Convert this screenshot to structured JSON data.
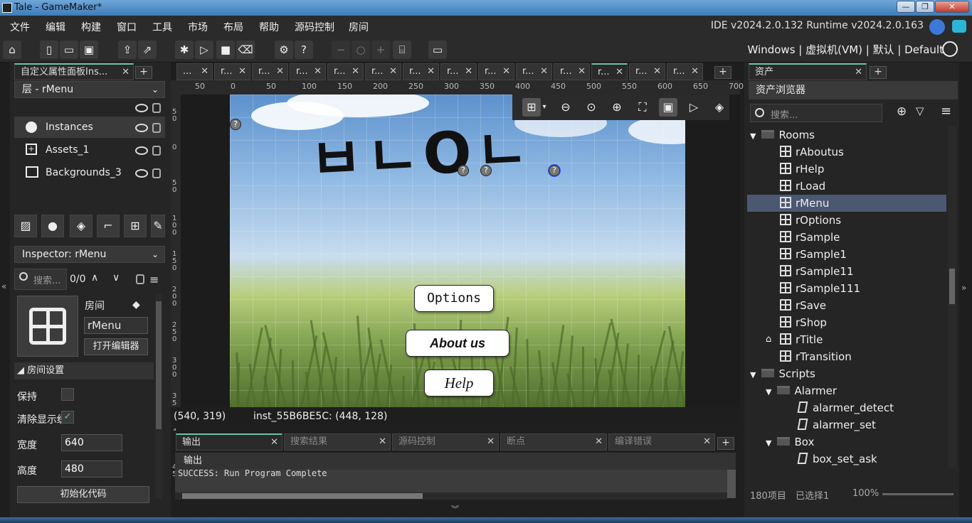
{
  "window": {
    "title": "Tale - GameMaker*",
    "min": "—",
    "max": "❐",
    "close": "✕"
  },
  "menu": [
    "文件",
    "编辑",
    "构建",
    "窗口",
    "工具",
    "市场",
    "布局",
    "帮助",
    "源码控制",
    "房间"
  ],
  "ide_info": "IDE v2024.2.0.132  Runtime v2024.2.0.163",
  "target": "Windows | 虚拟机(VM) | 默认 | Default",
  "left_panel": {
    "tab": "自定义属性面板Ins...",
    "layer_dropdown": "层 - rMenu",
    "layers": [
      {
        "name": "Instances",
        "icon": "instances-icon"
      },
      {
        "name": "Assets_1",
        "icon": "assets-layer-icon"
      },
      {
        "name": "Backgrounds_3",
        "icon": "background-layer-icon"
      }
    ],
    "inspector_dropdown": "Inspector: rMenu",
    "search_placeholder": "搜索...",
    "search_count": "0/0",
    "room_kind_label": "房间",
    "room_name": "rMenu",
    "open_editor": "打开编辑器",
    "section": "房间设置",
    "persistent_label": "保持",
    "clear_display_label": "清除显示缓",
    "width_label": "宽度",
    "width_value": "640",
    "height_label": "高度",
    "height_value": "480",
    "init_code": "初始化代码"
  },
  "editor_tabs": [
    "...",
    "r...",
    "r...",
    "r...",
    "r...",
    "r...",
    "r...",
    "r...",
    "r...",
    "r...",
    "r...",
    "r...",
    "r...",
    "r..."
  ],
  "ruler_top": [
    "50",
    "0",
    "50",
    "100",
    "150",
    "200",
    "250",
    "300",
    "350",
    "400",
    "450",
    "500",
    "550",
    "600",
    "650",
    "700"
  ],
  "ruler_left": [
    "5\n0",
    "0",
    "5\n0",
    "1\n0\n0",
    "1\n5\n0",
    "2\n0\n0",
    "2\n5\n0",
    "3\n0\n0",
    "3\n5\n0",
    "4\n0\n0",
    "4\n5"
  ],
  "room": {
    "logo_text": "ㅂㄴOㄴ",
    "buttons": {
      "options": "Options",
      "about": "About us",
      "help": "Help"
    },
    "marker": "?"
  },
  "status": {
    "cursor": "(540, 319)",
    "instance": "inst_55B6BE5C: (448, 128)"
  },
  "output": {
    "tabs": [
      "输出",
      "搜索结果",
      "源码控制",
      "断点",
      "编译错误"
    ],
    "header": "输出",
    "text": "SUCCESS: Run Program Complete"
  },
  "assets": {
    "tab": "资产",
    "browser_title": "资产浏览器",
    "search_placeholder": "搜索...",
    "rooms_folder": "Rooms",
    "rooms": [
      "rAboutus",
      "rHelp",
      "rLoad",
      "rMenu",
      "rOptions",
      "rSample",
      "rSample1",
      "rSample11",
      "rSample111",
      "rSave",
      "rShop",
      "rTitle",
      "rTransition"
    ],
    "selected_room": "rMenu",
    "scripts_folder": "Scripts",
    "alarmer_folder": "Alarmer",
    "alarmer_scripts": [
      "alarmer_detect",
      "alarmer_set"
    ],
    "box_folder": "Box",
    "box_scripts": [
      "box_set_ask"
    ],
    "footer_count": "180项目",
    "footer_selected": "已选择1",
    "zoom": "100%"
  },
  "colors": {
    "accent": "#6ec1a7",
    "selection": "#4b5872"
  }
}
